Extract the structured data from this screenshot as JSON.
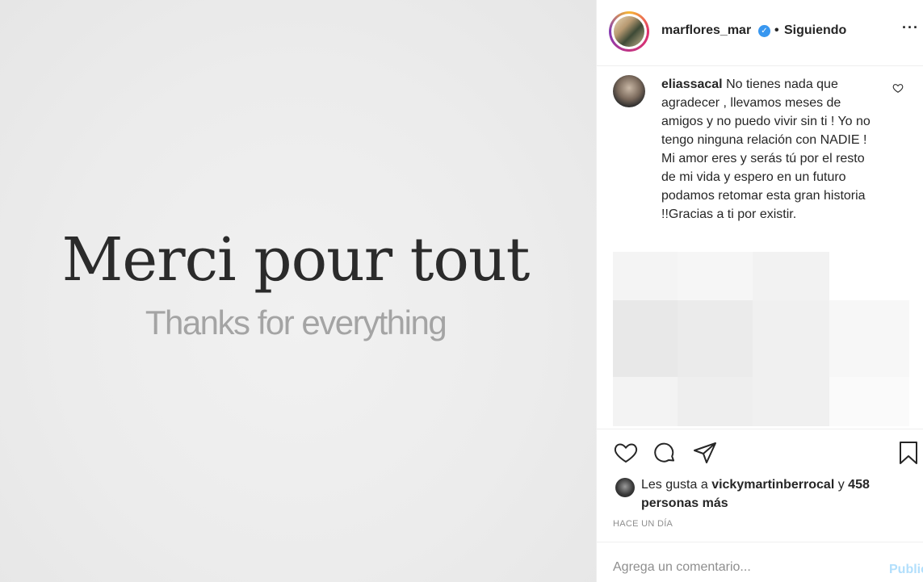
{
  "media": {
    "title": "Merci pour tout",
    "subtitle": "Thanks for everything"
  },
  "header": {
    "username": "marflores_mar",
    "verified_glyph": "✓",
    "separator": "•",
    "follow_state": "Siguiendo",
    "more_glyph": "···"
  },
  "comment": {
    "author": "eliassacal",
    "text": "No tienes nada que agradecer , llevamos meses de amigos y no puedo vivir sin ti ! Yo no tengo ninguna relación con NADIE ! Mi amor eres y serás tú por el resto de mi vida y espero en un futuro podamos retomar esta gran historia !!Gracias a ti por existir."
  },
  "actions": {
    "icons": [
      "heart-icon",
      "comment-icon",
      "share-icon",
      "bookmark-icon"
    ]
  },
  "likes": {
    "prefix": "Les gusta a",
    "user": "vickymartinberrocal",
    "connector": "y",
    "others": "458 personas más"
  },
  "timestamp": "HACE UN DÍA",
  "add_comment": {
    "placeholder": "Agrega un comentario...",
    "publish_label": "Publicar"
  },
  "colors": {
    "accent": "#3897f0",
    "publish_disabled": "#b2dffc",
    "muted": "#8e8e8e"
  }
}
